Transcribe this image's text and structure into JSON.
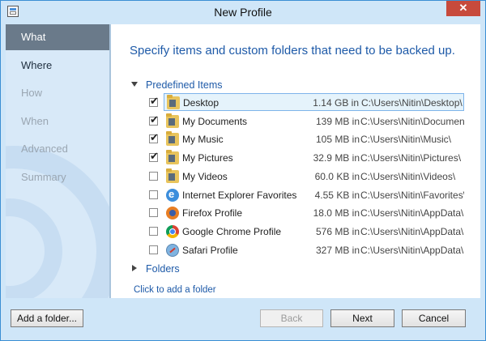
{
  "window": {
    "title": "New Profile",
    "close_symbol": "✕"
  },
  "sidebar": {
    "items": [
      {
        "label": "What",
        "state": "active"
      },
      {
        "label": "Where",
        "state": "enabled"
      },
      {
        "label": "How",
        "state": "disabled"
      },
      {
        "label": "When",
        "state": "disabled"
      },
      {
        "label": "Advanced",
        "state": "disabled"
      },
      {
        "label": "Summary",
        "state": "disabled"
      }
    ]
  },
  "main": {
    "heading": "Specify items and custom folders that need to be backed up.",
    "predefined_label": "Predefined Items",
    "folders_label": "Folders",
    "add_folder_link": "Click to add a folder",
    "items": [
      {
        "name": "Desktop",
        "size": "1.14 GB in",
        "path": "C:\\Users\\Nitin\\Desktop\\",
        "checked": true,
        "icon": "folder-icon",
        "selected": true
      },
      {
        "name": "My Documents",
        "size": "139 MB in",
        "path": "C:\\Users\\Nitin\\Documen...",
        "checked": true,
        "icon": "folder-icon"
      },
      {
        "name": "My Music",
        "size": "105 MB in",
        "path": "C:\\Users\\Nitin\\Music\\",
        "checked": true,
        "icon": "folder-icon"
      },
      {
        "name": "My Pictures",
        "size": "32.9 MB in",
        "path": "C:\\Users\\Nitin\\Pictures\\",
        "checked": true,
        "icon": "folder-icon"
      },
      {
        "name": "My Videos",
        "size": "60.0 KB in",
        "path": "C:\\Users\\Nitin\\Videos\\",
        "checked": false,
        "icon": "folder-icon"
      },
      {
        "name": "Internet Explorer Favorites",
        "size": "4.55 KB in",
        "path": "C:\\Users\\Nitin\\Favorites\\",
        "checked": false,
        "icon": "ie-icon"
      },
      {
        "name": "Firefox Profile",
        "size": "18.0 MB in",
        "path": "C:\\Users\\Nitin\\AppData\\...",
        "checked": false,
        "icon": "firefox-icon"
      },
      {
        "name": "Google Chrome Profile",
        "size": "576 MB in",
        "path": "C:\\Users\\Nitin\\AppData\\...",
        "checked": false,
        "icon": "chrome-icon"
      },
      {
        "name": "Safari Profile",
        "size": "327 MB in",
        "path": "C:\\Users\\Nitin\\AppData\\...",
        "checked": false,
        "icon": "safari-icon"
      }
    ]
  },
  "footer": {
    "add_folder_button": "Add a folder...",
    "back_button": "Back",
    "next_button": "Next",
    "cancel_button": "Cancel"
  },
  "colors": {
    "accent": "#1e5aa8",
    "frame": "#cfe6f8",
    "sidebar_active": "#6a7a8a",
    "close": "#c74a3c"
  }
}
